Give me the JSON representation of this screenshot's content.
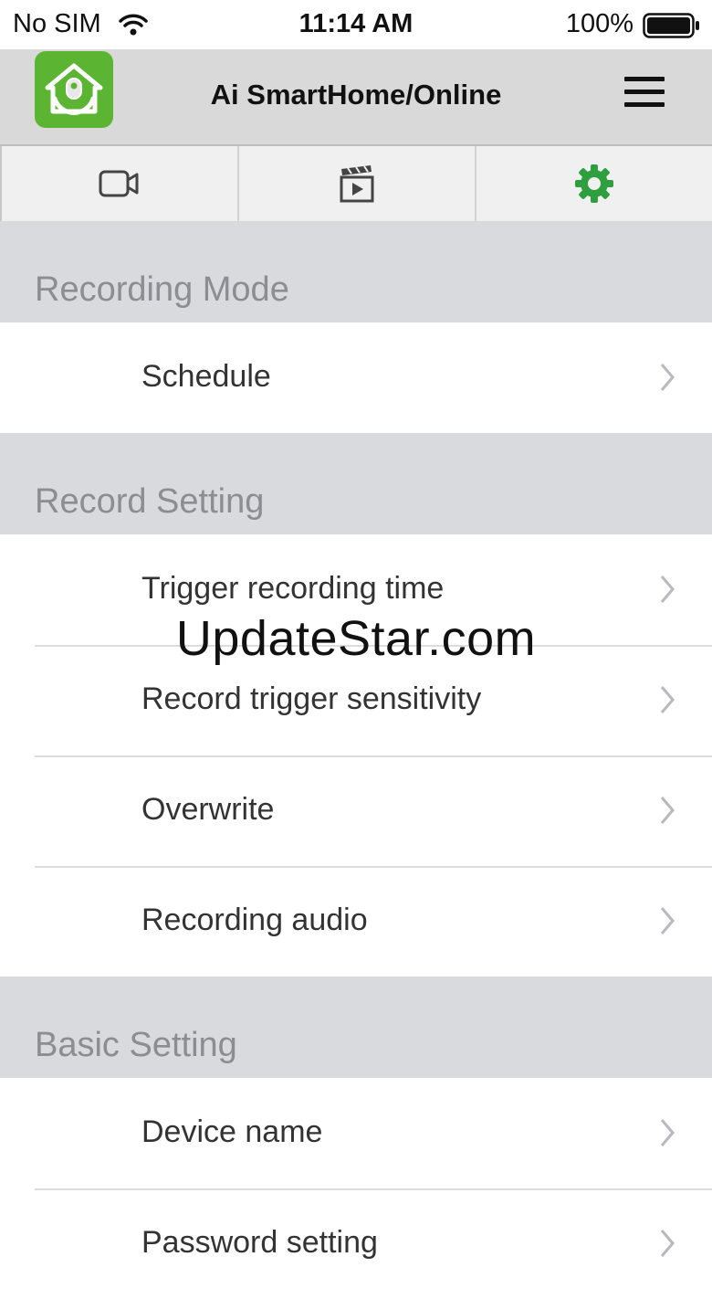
{
  "status_bar": {
    "carrier": "No SIM",
    "time": "11:14 AM",
    "battery": "100%"
  },
  "header": {
    "title": "Ai SmartHome/Online",
    "logo_color": "#5cb532"
  },
  "tabs": [
    {
      "name": "video-camera-icon",
      "active": false
    },
    {
      "name": "clapperboard-icon",
      "active": false
    },
    {
      "name": "gear-icon",
      "active": true,
      "color": "#2e9e3e"
    }
  ],
  "sections": [
    {
      "title": "Recording Mode",
      "items": [
        "Schedule"
      ]
    },
    {
      "title": "Record Setting",
      "items": [
        "Trigger recording time",
        "Record trigger sensitivity",
        "Overwrite",
        "Recording audio"
      ]
    },
    {
      "title": "Basic Setting",
      "items": [
        "Device name",
        "Password setting"
      ]
    }
  ],
  "watermark": "UpdateStar.com"
}
